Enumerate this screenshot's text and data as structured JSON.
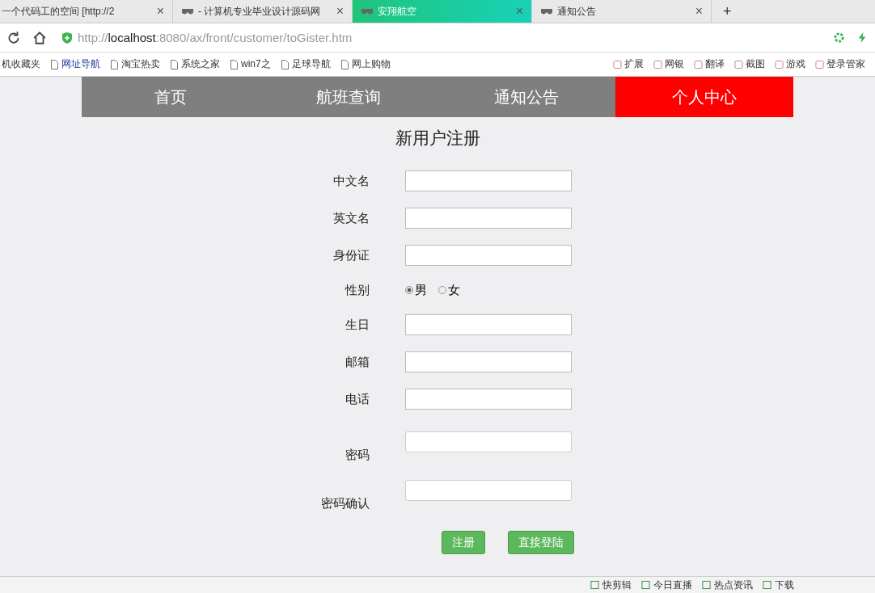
{
  "browser": {
    "tabs": [
      {
        "title": "一个代码工的空间 [http://2",
        "selected": false,
        "has_icon": false
      },
      {
        "title": "- 计算机专业毕业设计源码网",
        "selected": false,
        "has_icon": true
      },
      {
        "title": "安翔航空",
        "selected": true,
        "has_icon": true
      },
      {
        "title": "通知公告",
        "selected": false,
        "has_icon": true
      }
    ],
    "close": "×",
    "new_tab": "+",
    "url": {
      "scheme": "http://",
      "host": "localhost",
      "path": ":8080/ax/front/customer/toGister.htm"
    },
    "bookmarks": [
      "机收藏夹",
      "网址导航",
      "淘宝热卖",
      "系统之家",
      "win7之",
      "足球导航",
      "网上购物"
    ],
    "tools": [
      "扩展",
      "网银",
      "翻译",
      "截图",
      "游戏",
      "登录管家"
    ],
    "status_items": [
      "快剪辑",
      "今日直播",
      "热点资讯",
      "下载"
    ]
  },
  "nav": [
    {
      "label": "首页",
      "selected": false
    },
    {
      "label": "航班查询",
      "selected": false
    },
    {
      "label": "通知公告",
      "selected": false
    },
    {
      "label": "个人中心",
      "selected": true
    }
  ],
  "title": "新用户注册",
  "fields": [
    {
      "label": "中文名",
      "kind": "text"
    },
    {
      "label": "英文名",
      "kind": "text"
    },
    {
      "label": "身份证",
      "kind": "text"
    },
    {
      "label": "性别",
      "kind": "radio",
      "options": [
        {
          "label": "男",
          "selected": true
        },
        {
          "label": "女",
          "selected": false
        }
      ]
    },
    {
      "label": "生日",
      "kind": "text"
    },
    {
      "label": "邮箱",
      "kind": "text"
    },
    {
      "label": "电话",
      "kind": "text"
    },
    {
      "label": "密码",
      "kind": "password"
    },
    {
      "label": "密码确认",
      "kind": "password"
    }
  ],
  "buttons": [
    "注册",
    "直接登陆"
  ]
}
